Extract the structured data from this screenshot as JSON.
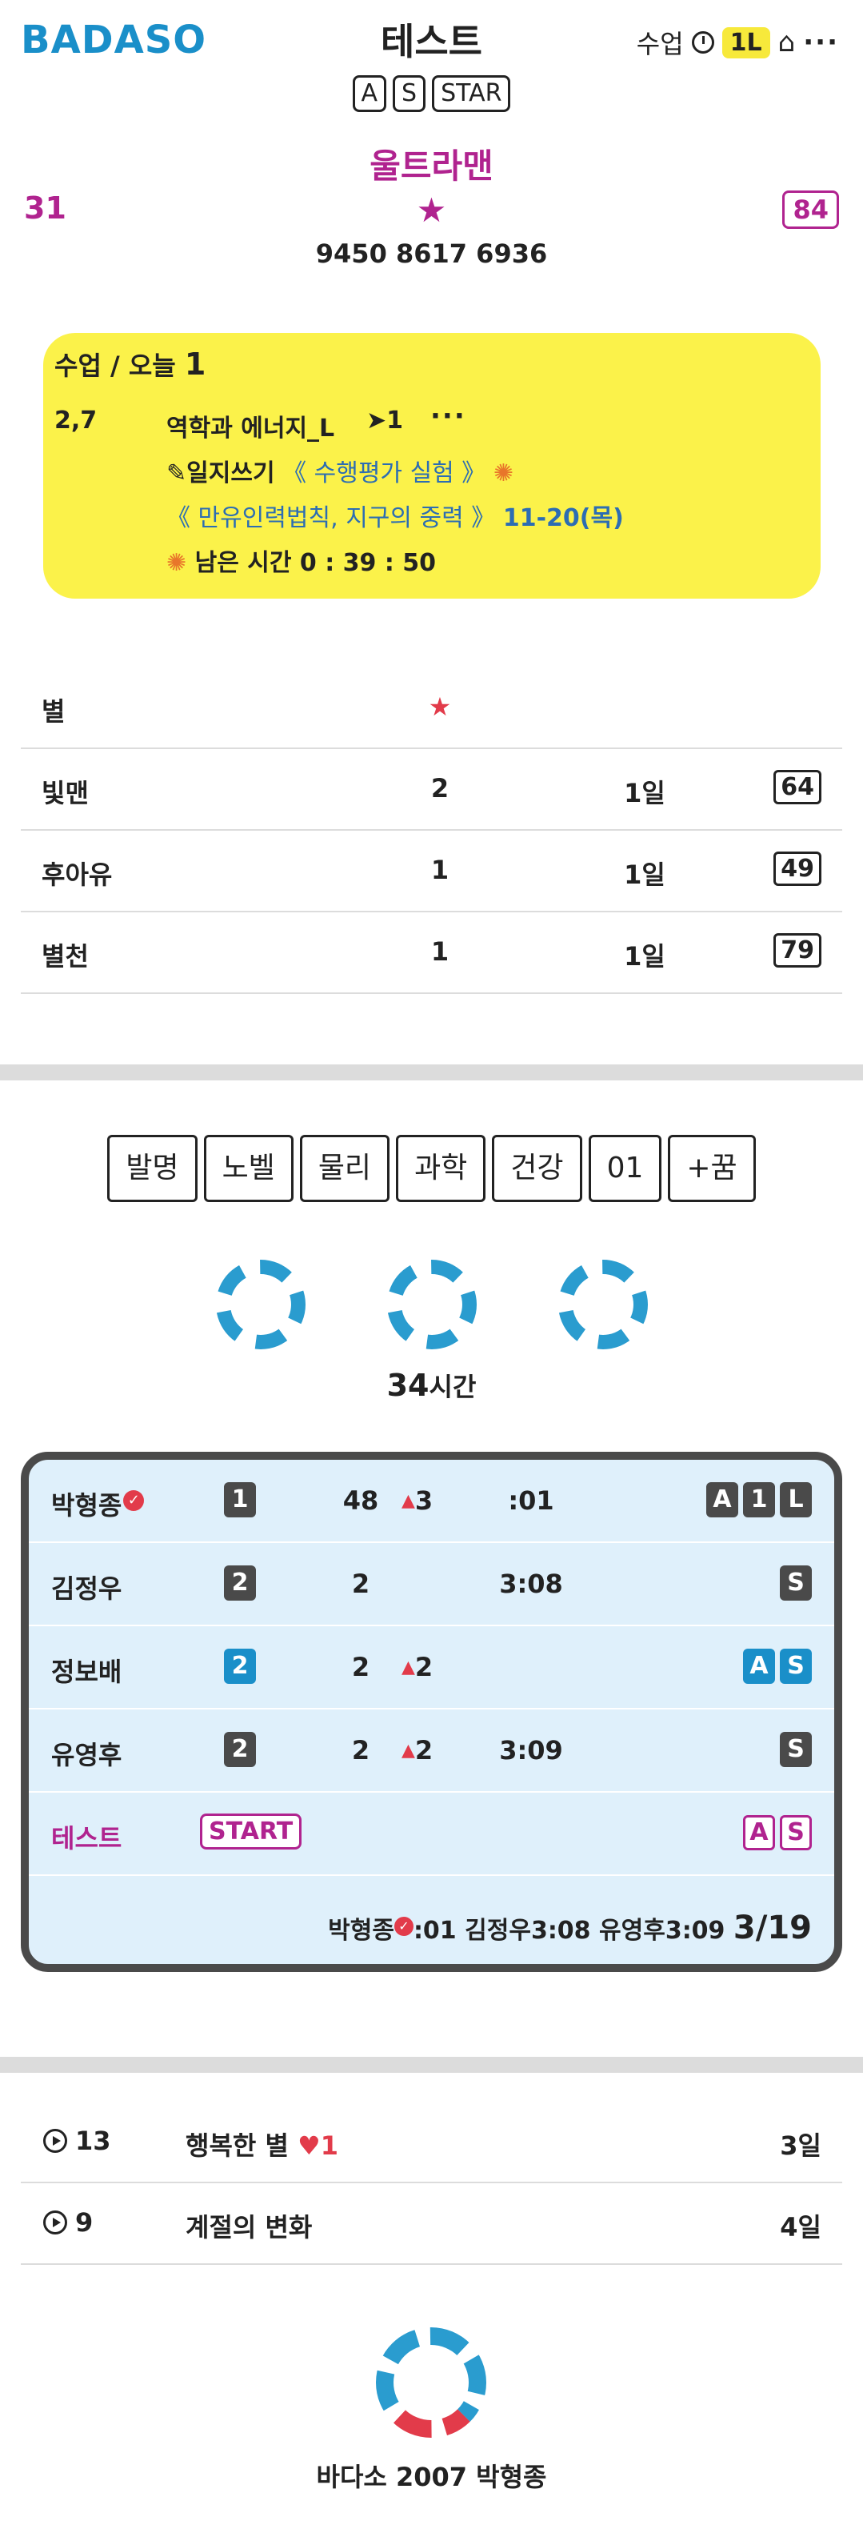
{
  "header": {
    "logo": "BADASO",
    "title": "테스트",
    "class_label": "수업",
    "level": "1L",
    "tags": [
      "A",
      "S",
      "STAR"
    ]
  },
  "user": {
    "name": "울트라맨",
    "left_count": "31",
    "right_count": "84",
    "phone": "9450 8617 6936"
  },
  "class_card": {
    "title": "수업 / 오늘",
    "count": "1",
    "period": "2,7",
    "subject": "역학과 에너지_L",
    "send": "➤1",
    "journal_label": "일지쓰기",
    "assessment": "《 수행평가 실험 》",
    "topic": "《 만유인력법칙, 지구의 중력 》",
    "date": "11-20(목)",
    "remaining_label": "남은 시간",
    "remaining_time": "0 : 39 : 50"
  },
  "stars_table": {
    "header_label": "별",
    "rows": [
      {
        "name": "빛맨",
        "count": "2",
        "days": "1일",
        "score": "64"
      },
      {
        "name": "후아유",
        "count": "1",
        "days": "1일",
        "score": "49"
      },
      {
        "name": "별천",
        "count": "1",
        "days": "1일",
        "score": "79"
      }
    ]
  },
  "categories": [
    "발명",
    "노벨",
    "물리",
    "과학",
    "건강",
    "01",
    "+꿈"
  ],
  "hours": {
    "value": "34",
    "unit": "시간"
  },
  "leaderboard": {
    "rows": [
      {
        "name": "박형종",
        "rank": "1",
        "score": "48",
        "delta": "3",
        "time": ":01",
        "badges": [
          "A",
          "1",
          "L"
        ]
      },
      {
        "name": "김정우",
        "rank": "2",
        "score": "2",
        "delta": "",
        "time": "3:08",
        "badges": [
          "S"
        ]
      },
      {
        "name": "정보배",
        "rank": "2",
        "score": "2",
        "delta": "2",
        "time": "",
        "badges": [
          "A",
          "S"
        ]
      },
      {
        "name": "유영후",
        "rank": "2",
        "score": "2",
        "delta": "2",
        "time": "3:09",
        "badges": [
          "S"
        ]
      }
    ],
    "self": {
      "name": "테스트",
      "start": "START",
      "badges": [
        "A",
        "S"
      ]
    },
    "summary": {
      "p1": "박형종",
      "t1": ":01",
      "p2": "김정우3:08",
      "p3": "유영후3:09",
      "ratio": "3/19"
    }
  },
  "bottom_list": [
    {
      "num": "13",
      "title": "행복한 별",
      "heart": "♥1",
      "days": "3일"
    },
    {
      "num": "9",
      "title": "계절의 변화",
      "heart": "",
      "days": "4일"
    }
  ],
  "footer": {
    "text": "바다소 2007 박형종"
  },
  "colors": {
    "brand": "#1a8fc9",
    "accent": "#b0238f",
    "highlight": "#fbf24a",
    "alert": "#e23b4a"
  }
}
